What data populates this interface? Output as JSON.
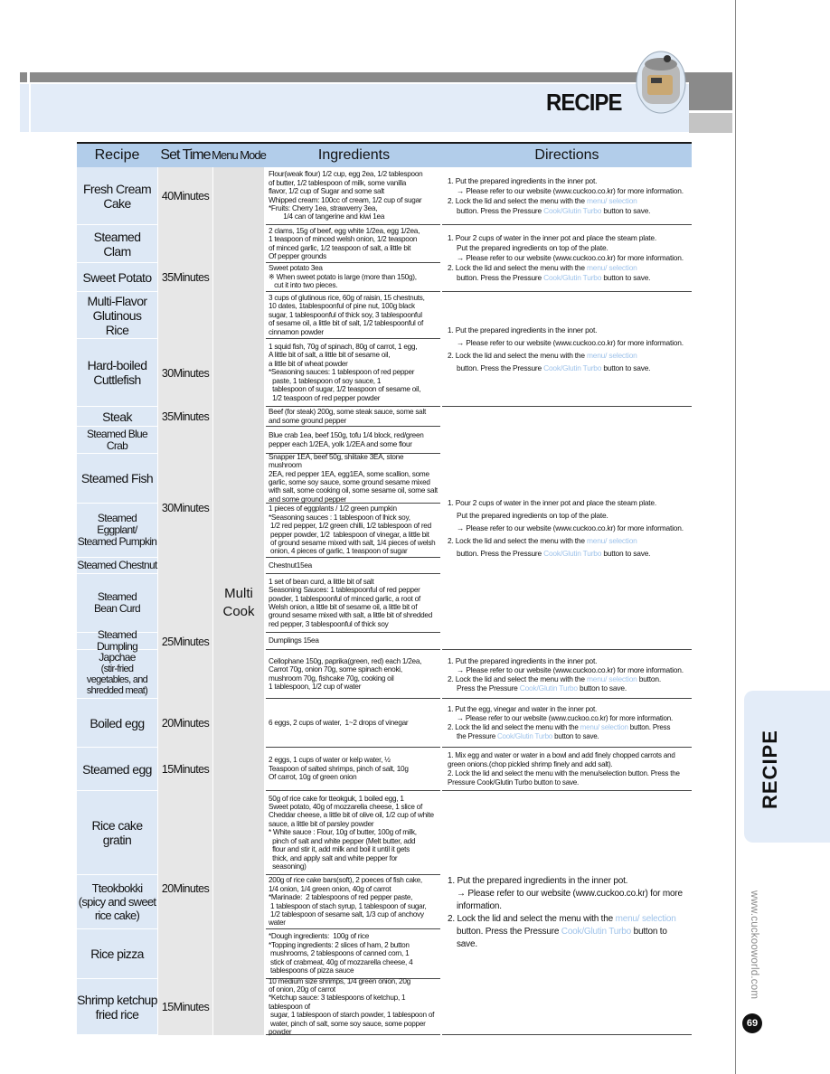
{
  "header": {
    "title": "RECIPE"
  },
  "side_tab": {
    "label": "RECIPE",
    "website": "www.cuckooworld.com",
    "page_number": "69"
  },
  "colors": {
    "header_blue": "#b2cdea",
    "band_blue": "#e3ecf8",
    "highlight": "#9fc3ea"
  },
  "table": {
    "headers": [
      "Recipe",
      "Set Time",
      "Menu Mode",
      "Ingredients",
      "Directions"
    ],
    "menu_mode": [
      "Multi",
      "Cook"
    ],
    "times": [
      "40Minutes",
      "35Minutes",
      "30Minutes",
      "35Minutes",
      "30Minutes",
      "25Minutes",
      "20Minutes",
      "15Minutes",
      "20Minutes",
      "15Minutes"
    ],
    "recipes": [
      {
        "name": [
          "Fresh Cream",
          "Cake"
        ],
        "ingredients": [
          "Flour(weak flour) 1/2 cup, egg 2ea, 1/2 tablespoon",
          "of butter, 1/2 tablespoon of milk, some vanilla",
          "flavor, 1/2 cup of Sugar and some salt",
          "Whipped cream: 100cc of cream, 1/2 cup of sugar",
          "*Fruits: Cherry 1ea, strawverry 3ea,",
          "        1/4 can of tangerine and kiwi 1ea"
        ]
      },
      {
        "name": [
          "Steamed",
          "Clam"
        ],
        "ingredients": [
          "2 clams, 15g of beef, egg white 1/2ea, egg 1/2ea,",
          "1 teaspoon of minced welsh onion, 1/2 teaspoon",
          "of minced garlic, 1/2 teaspoon of salt, a little bit",
          "Of pepper grounds"
        ]
      },
      {
        "name": [
          "Sweet Potato"
        ],
        "ingredients": [
          "Sweet potato 3ea",
          "※ When sweet potato is large (more than 150g),",
          "   cut it into two pieces."
        ]
      },
      {
        "name": [
          "Multi-Flavor",
          "Glutinous",
          "Rice"
        ],
        "ingredients": [
          "3 cups of glutinous rice, 60g of raisin, 15 chestnuts,",
          "10 dates, 1tablespoonful of pine nut, 100g black",
          "sugar, 1 tablespoonful of thick soy, 3 tablespoonful",
          "of sesame oil, a little bit of salt, 1/2 tablespoonful of",
          "cinnamon powder"
        ]
      },
      {
        "name": [
          "Hard-boiled",
          "Cuttlefish"
        ],
        "ingredients": [
          "1 squid fish, 70g of spinach, 80g of carrot, 1 egg,",
          "A little bit of salt, a little bit of sesame oil,",
          "a little bit of wheat powder",
          "*Seasoning sauces: 1 tablespoon of red pepper",
          "  paste, 1 tablespoon of soy sauce, 1",
          "  tablespoon of sugar, 1/2 teaspoon of sesame oil,",
          "  1/2 teaspoon of red pepper powder"
        ]
      },
      {
        "name": [
          "Steak"
        ],
        "ingredients": [
          "Beef (for steak) 200g, some steak sauce, some salt",
          "and some ground pepper"
        ]
      },
      {
        "name": [
          "Steamed Blue",
          "Crab"
        ],
        "ingredients": [
          "Blue crab 1ea, beef 150g, tofu 1/4 block, red/green",
          "pepper each 1/2EA, yolk 1/2EA and some flour"
        ]
      },
      {
        "name": [
          "Steamed Fish"
        ],
        "ingredients": [
          "Snapper 1EA, beef 50g, shiitake 3EA, stone mushroom",
          "2EA, red pepper 1EA, egg1EA, some scallion, some",
          "garlic, some soy sauce, some ground sesame mixed",
          "with salt, some cooking oil, some sesame oil, some salt",
          "and some ground pepper"
        ]
      },
      {
        "name": [
          "Steamed",
          "Eggplant/",
          "Steamed Pumpkin"
        ],
        "ingredients": [
          "1 pieces of eggplants / 1/2 green pumpkin",
          "*Seasoning sauces : 1 tablespoon of lhick soy,",
          " 1/2 red pepper, 1/2 green chilli, 1/2 tablespoon of red",
          " pepper powder, 1/2  tablespoon of vinegar, a little bit",
          " of ground sesame mixed with salt, 1/4 pieces of welsh",
          " onion, 4 pieces of garlic, 1 teaspoon of sugar"
        ]
      },
      {
        "name": [
          "Steamed Chestnut"
        ],
        "ingredients": [
          "Chestnut15ea"
        ]
      },
      {
        "name": [
          "Steamed",
          "Bean Curd"
        ],
        "ingredients": [
          "1 set of bean curd, a little bit of salt",
          "Seasoning Sauces: 1 tablespoonful of red pepper",
          "powder, 1 tablespoonful of minced garlic, a root of",
          "Welsh onion, a little bit of sesame oil, a little bit of",
          "ground sesame mixed with salt, a little bit of shredded",
          "red pepper, 3 tablespoonful of thick soy"
        ]
      },
      {
        "name": [
          "Steamed Dumpling"
        ],
        "ingredients": [
          "Dumplings 15ea"
        ]
      },
      {
        "name": [
          "Japchae"
        ],
        "sub": [
          "(stir-fried",
          "vegetables, and",
          "shredded meat)"
        ],
        "ingredients": [
          "Cellophane 150g, paprika(green, red) each 1/2ea,",
          "Carrot 70g, onion 70g, some spinach enoki,",
          "mushroom 70g, fishcake 70g, cooking oil",
          "1 tablespoon, 1/2 cup of water"
        ]
      },
      {
        "name": [
          "Boiled egg"
        ],
        "ingredients": [
          "6 eggs, 2 cups of water,  1~2 drops of vinegar"
        ]
      },
      {
        "name": [
          "Steamed egg"
        ],
        "ingredients": [
          "2 eggs, 1 cups of water or kelp water, ½",
          "Teaspoon of salted shrimps, pinch of salt, 10g",
          "Of carrot, 10g of green onion"
        ]
      },
      {
        "name": [
          "Rice cake",
          "gratin"
        ],
        "ingredients": [
          "50g of rice cake for tteokguk, 1 boiled egg, 1",
          "Sweet potato, 40g of mozzarella cheese, 1 slice of",
          "Cheddar cheese, a little bit of olive oil, 1/2 cup of white",
          "sauce, a little bit of parsley powder",
          "* White sauce : Flour, 10g of butter, 100g of milk,",
          "  pinch of salt and white pepper (Melt butter, add",
          "  flour and stir it, add milk and boil it until it gets",
          "  thick, and apply salt and white pepper for",
          "  seasoning)"
        ]
      },
      {
        "name": [
          "Tteokbokki",
          "(spicy and sweet",
          "rice cake)"
        ],
        "ingredients": [
          "200g of rice cake bars(soft), 2 poeces of fish cake,",
          "1/4 onion, 1/4 green onion, 40g of carrot",
          "*Marinade:  2 tablespoons of red pepper paste,",
          " 1 tablespoon of stach syrup, 1 tablespoon of sugar,",
          " 1/2 tablespoon of sesame salt, 1/3 cup of anchovy water"
        ]
      },
      {
        "name": [
          "Rice pizza"
        ],
        "ingredients": [
          "*Dough ingredients:  100g of rice",
          "*Topping ingredients: 2 slices of ham, 2 button",
          " mushrooms, 2 tablespoons of canned corn, 1",
          " stick of crabmeat, 40g of mozzarella cheese, 4",
          " tablespoons of pizza sauce"
        ]
      },
      {
        "name": [
          "Shrimp ketchup",
          "fried rice"
        ],
        "ingredients": [
          "10 medium size shrimps, 1/4 green onion, 20g",
          "of onion, 20g of carrot",
          "*Ketchup sauce: 3 tablespoons of ketchup, 1 tablespoon of",
          " sugar, 1 tablespoon of starch powder, 1 tablespoon of",
          " water, pinch of salt, some soy sauce, some popper powder"
        ]
      }
    ],
    "directions": {
      "put": {
        "step1": "1. Put the prepared ingredients in the inner pot.",
        "note": "→ Please refer to our website (www.cuckoo.co.kr) for more information.",
        "step2_pre": "2. Lock the lid and select the menu with the",
        "menu_selection": "menu/ selection",
        "button_press": "button. Press the Pressure",
        "cook_turbo": "Cook/Glutin Turbo",
        "to_save": "button to save."
      },
      "pour": {
        "step1": "1. Pour 2 cups of water in the inner pot and place the steam plate.",
        "step1b": "Put the prepared ingredients on top of the plate.",
        "note": "→ Please refer to our website (www.cuckoo.co.kr) for more information."
      },
      "egg": {
        "step1": "1. Put the egg, vinegar and water in the inner pot.",
        "note": "→ Please refer to our website (www.cuckoo.co.kr) for more information.",
        "step2_pre": "2. Lock the lid and select the menu with the",
        "button_press": "button. Press the Pressure",
        "to_save": "button to save."
      },
      "steamed_egg": {
        "step1": "1. Mix egg and water or water in a bowl and add finely chopped carrots and green onions.(chop pickled shrimp finely and add salt).",
        "step2": "2. Lock the lid and select the menu with the menu/selection button. Press the Pressure Cook/Glutin Turbo button to save."
      }
    }
  }
}
